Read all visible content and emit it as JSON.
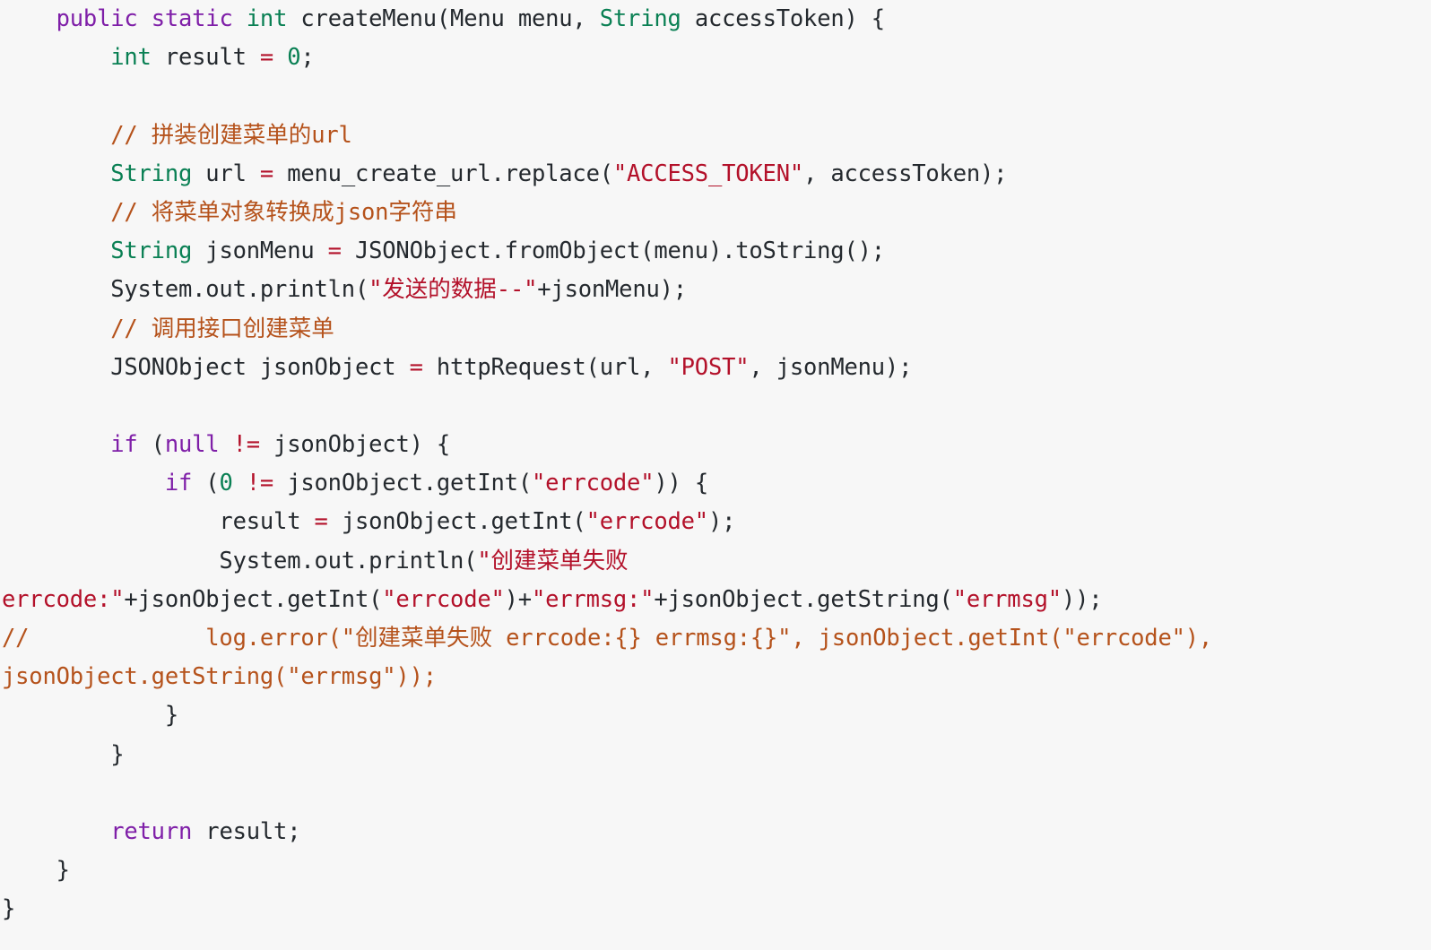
{
  "editor": {
    "language": "Java",
    "background_color": "#f7f7f7",
    "font_size_px": 25.5,
    "line_height_px": 43.2,
    "theme": {
      "plain_color": "#24292e",
      "keyword_color": "#7f1fa8",
      "type_color": "#0a8054",
      "string_color": "#b3112a",
      "number_color": "#0a8054",
      "operator_color": "#b3112a",
      "comment_color": "#b5521b"
    }
  },
  "code": {
    "lines": [
      {
        "id": "line-1",
        "tokens": [
          {
            "t": "plain",
            "v": "    "
          },
          {
            "t": "kw",
            "v": "public"
          },
          {
            "t": "plain",
            "v": " "
          },
          {
            "t": "kw",
            "v": "static"
          },
          {
            "t": "plain",
            "v": " "
          },
          {
            "t": "type",
            "v": "int"
          },
          {
            "t": "plain",
            "v": " createMenu(Menu menu, "
          },
          {
            "t": "type",
            "v": "String"
          },
          {
            "t": "plain",
            "v": " accessToken) {"
          }
        ]
      },
      {
        "id": "line-2",
        "tokens": [
          {
            "t": "plain",
            "v": "        "
          },
          {
            "t": "type",
            "v": "int"
          },
          {
            "t": "plain",
            "v": " result "
          },
          {
            "t": "op",
            "v": "="
          },
          {
            "t": "plain",
            "v": " "
          },
          {
            "t": "num",
            "v": "0"
          },
          {
            "t": "plain",
            "v": ";"
          }
        ]
      },
      {
        "id": "line-3",
        "tokens": [
          {
            "t": "plain",
            "v": ""
          }
        ]
      },
      {
        "id": "line-4",
        "tokens": [
          {
            "t": "plain",
            "v": "        "
          },
          {
            "t": "cmt",
            "v": "// "
          },
          {
            "t": "cmt-cjk",
            "v": "拼装创建菜单的"
          },
          {
            "t": "cmt",
            "v": "url"
          }
        ]
      },
      {
        "id": "line-5",
        "tokens": [
          {
            "t": "plain",
            "v": "        "
          },
          {
            "t": "type",
            "v": "String"
          },
          {
            "t": "plain",
            "v": " url "
          },
          {
            "t": "op",
            "v": "="
          },
          {
            "t": "plain",
            "v": " menu_create_url.replace("
          },
          {
            "t": "str",
            "v": "\"ACCESS_TOKEN\""
          },
          {
            "t": "plain",
            "v": ", accessToken);"
          }
        ]
      },
      {
        "id": "line-6",
        "tokens": [
          {
            "t": "plain",
            "v": "        "
          },
          {
            "t": "cmt",
            "v": "// "
          },
          {
            "t": "cmt-cjk",
            "v": "将菜单对象转换成"
          },
          {
            "t": "cmt",
            "v": "json"
          },
          {
            "t": "cmt-cjk",
            "v": "字符串"
          }
        ]
      },
      {
        "id": "line-7",
        "tokens": [
          {
            "t": "plain",
            "v": "        "
          },
          {
            "t": "type",
            "v": "String"
          },
          {
            "t": "plain",
            "v": " jsonMenu "
          },
          {
            "t": "op",
            "v": "="
          },
          {
            "t": "plain",
            "v": " JSONObject.fromObject(menu).toString();"
          }
        ]
      },
      {
        "id": "line-8",
        "tokens": [
          {
            "t": "plain",
            "v": "        System.out.println("
          },
          {
            "t": "str",
            "v": "\""
          },
          {
            "t": "str-cjk",
            "v": "发送的数据"
          },
          {
            "t": "str",
            "v": "--\""
          },
          {
            "t": "plain",
            "v": "+jsonMenu);"
          }
        ]
      },
      {
        "id": "line-9",
        "tokens": [
          {
            "t": "plain",
            "v": "        "
          },
          {
            "t": "cmt",
            "v": "// "
          },
          {
            "t": "cmt-cjk",
            "v": "调用接口创建菜单"
          }
        ]
      },
      {
        "id": "line-10",
        "tokens": [
          {
            "t": "plain",
            "v": "        JSONObject jsonObject "
          },
          {
            "t": "op",
            "v": "="
          },
          {
            "t": "plain",
            "v": " httpRequest(url, "
          },
          {
            "t": "str",
            "v": "\"POST\""
          },
          {
            "t": "plain",
            "v": ", jsonMenu);"
          }
        ]
      },
      {
        "id": "line-11",
        "tokens": [
          {
            "t": "plain",
            "v": ""
          }
        ]
      },
      {
        "id": "line-12",
        "tokens": [
          {
            "t": "plain",
            "v": "        "
          },
          {
            "t": "kw",
            "v": "if"
          },
          {
            "t": "plain",
            "v": " ("
          },
          {
            "t": "kw",
            "v": "null"
          },
          {
            "t": "plain",
            "v": " "
          },
          {
            "t": "op",
            "v": "!="
          },
          {
            "t": "plain",
            "v": " jsonObject) {"
          }
        ]
      },
      {
        "id": "line-13",
        "tokens": [
          {
            "t": "plain",
            "v": "            "
          },
          {
            "t": "kw",
            "v": "if"
          },
          {
            "t": "plain",
            "v": " ("
          },
          {
            "t": "num",
            "v": "0"
          },
          {
            "t": "plain",
            "v": " "
          },
          {
            "t": "op",
            "v": "!="
          },
          {
            "t": "plain",
            "v": " jsonObject.getInt("
          },
          {
            "t": "str",
            "v": "\"errcode\""
          },
          {
            "t": "plain",
            "v": ")) {"
          }
        ]
      },
      {
        "id": "line-14",
        "tokens": [
          {
            "t": "plain",
            "v": "                result "
          },
          {
            "t": "op",
            "v": "="
          },
          {
            "t": "plain",
            "v": " jsonObject.getInt("
          },
          {
            "t": "str",
            "v": "\"errcode\""
          },
          {
            "t": "plain",
            "v": ");"
          }
        ]
      },
      {
        "id": "line-15",
        "tokens": [
          {
            "t": "plain",
            "v": "                System.out.println("
          },
          {
            "t": "str",
            "v": "\""
          },
          {
            "t": "str-cjk",
            "v": "创建菜单失败"
          }
        ]
      },
      {
        "id": "line-16",
        "tokens": [
          {
            "t": "str",
            "v": "errcode:\""
          },
          {
            "t": "plain",
            "v": "+jsonObject.getInt("
          },
          {
            "t": "str",
            "v": "\"errcode\""
          },
          {
            "t": "plain",
            "v": ")+"
          },
          {
            "t": "str",
            "v": "\"errmsg:\""
          },
          {
            "t": "plain",
            "v": "+jsonObject.getString("
          },
          {
            "t": "str",
            "v": "\"errmsg\""
          },
          {
            "t": "plain",
            "v": "));"
          }
        ]
      },
      {
        "id": "line-17",
        "tokens": [
          {
            "t": "cmt",
            "v": "//             log.error(\""
          },
          {
            "t": "cmt-cjk",
            "v": "创建菜单失败"
          },
          {
            "t": "cmt",
            "v": " errcode:{} errmsg:{}\", jsonObject.getInt(\"errcode\"),"
          }
        ]
      },
      {
        "id": "line-18",
        "tokens": [
          {
            "t": "cmt",
            "v": "jsonObject.getString(\"errmsg\"));"
          }
        ]
      },
      {
        "id": "line-19",
        "tokens": [
          {
            "t": "plain",
            "v": "            }"
          }
        ]
      },
      {
        "id": "line-20",
        "tokens": [
          {
            "t": "plain",
            "v": "        }"
          }
        ]
      },
      {
        "id": "line-21",
        "tokens": [
          {
            "t": "plain",
            "v": ""
          }
        ]
      },
      {
        "id": "line-22",
        "tokens": [
          {
            "t": "plain",
            "v": "        "
          },
          {
            "t": "kw",
            "v": "return"
          },
          {
            "t": "plain",
            "v": " result;"
          }
        ]
      },
      {
        "id": "line-23",
        "tokens": [
          {
            "t": "plain",
            "v": "    }"
          }
        ]
      },
      {
        "id": "line-24",
        "tokens": [
          {
            "t": "plain",
            "v": "}"
          }
        ]
      }
    ]
  }
}
